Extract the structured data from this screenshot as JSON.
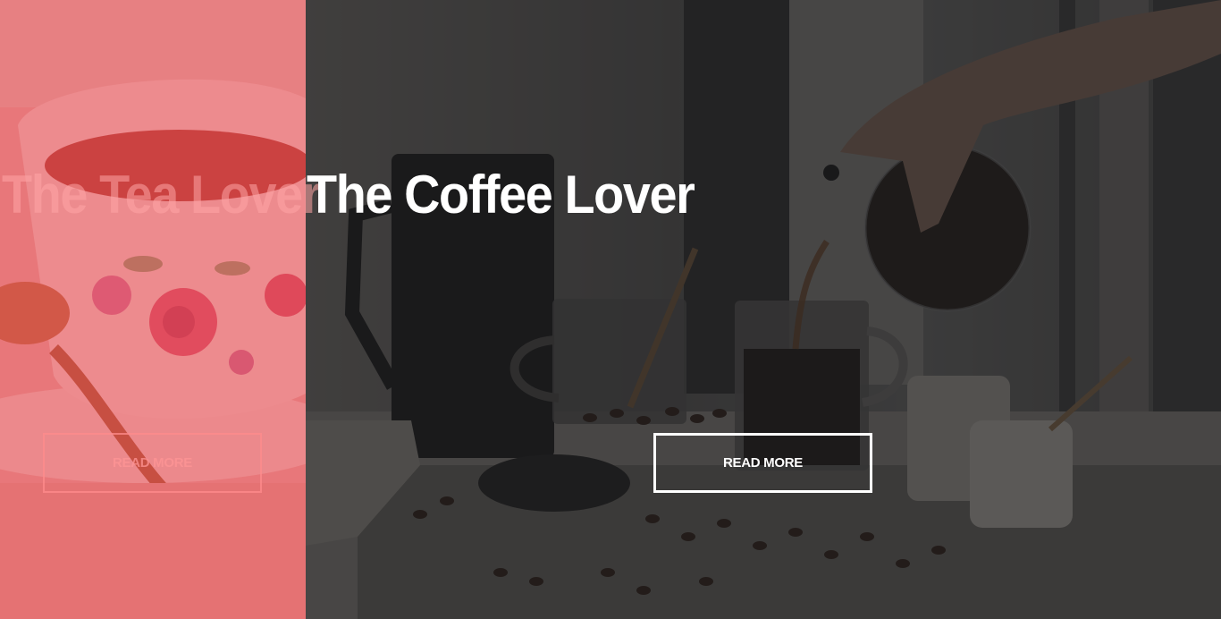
{
  "panels": [
    {
      "id": "tea",
      "title": "The Tea Lover",
      "button_label": "READ MORE",
      "overlay_color": "#e84854"
    },
    {
      "id": "coffee",
      "title": "The Coffee Lover",
      "button_label": "READ MORE",
      "overlay_color": "#1e1e20"
    }
  ],
  "colors": {
    "tea_text": "#ffa5a5",
    "coffee_text": "#ffffff"
  }
}
